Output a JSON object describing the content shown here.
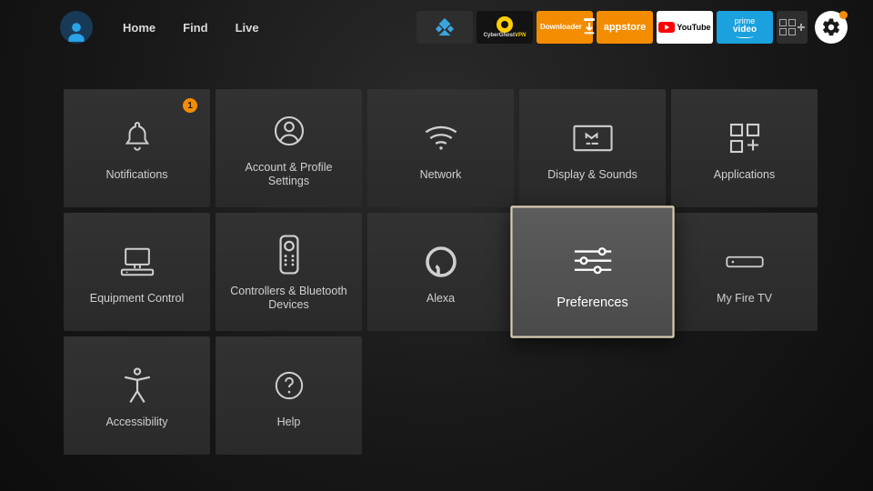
{
  "nav": {
    "home": "Home",
    "find": "Find",
    "live": "Live"
  },
  "apps": {
    "ghost_line1": "CyberGhost",
    "ghost_line2": "VPN",
    "downloader": "Downloader",
    "appstore": "appstore",
    "youtube": "YouTube",
    "prime1": "prime",
    "prime2": "video"
  },
  "tiles": [
    {
      "label": "Notifications",
      "badge": "1"
    },
    {
      "label": "Account & Profile Settings"
    },
    {
      "label": "Network"
    },
    {
      "label": "Display & Sounds"
    },
    {
      "label": "Applications"
    },
    {
      "label": "Equipment Control"
    },
    {
      "label": "Controllers & Bluetooth Devices"
    },
    {
      "label": "Alexa"
    },
    {
      "label": "Preferences",
      "selected": true
    },
    {
      "label": "My Fire TV"
    },
    {
      "label": "Accessibility"
    },
    {
      "label": "Help"
    }
  ],
  "colors": {
    "accent": "#f48c00",
    "select_border": "#d7ccb2"
  }
}
